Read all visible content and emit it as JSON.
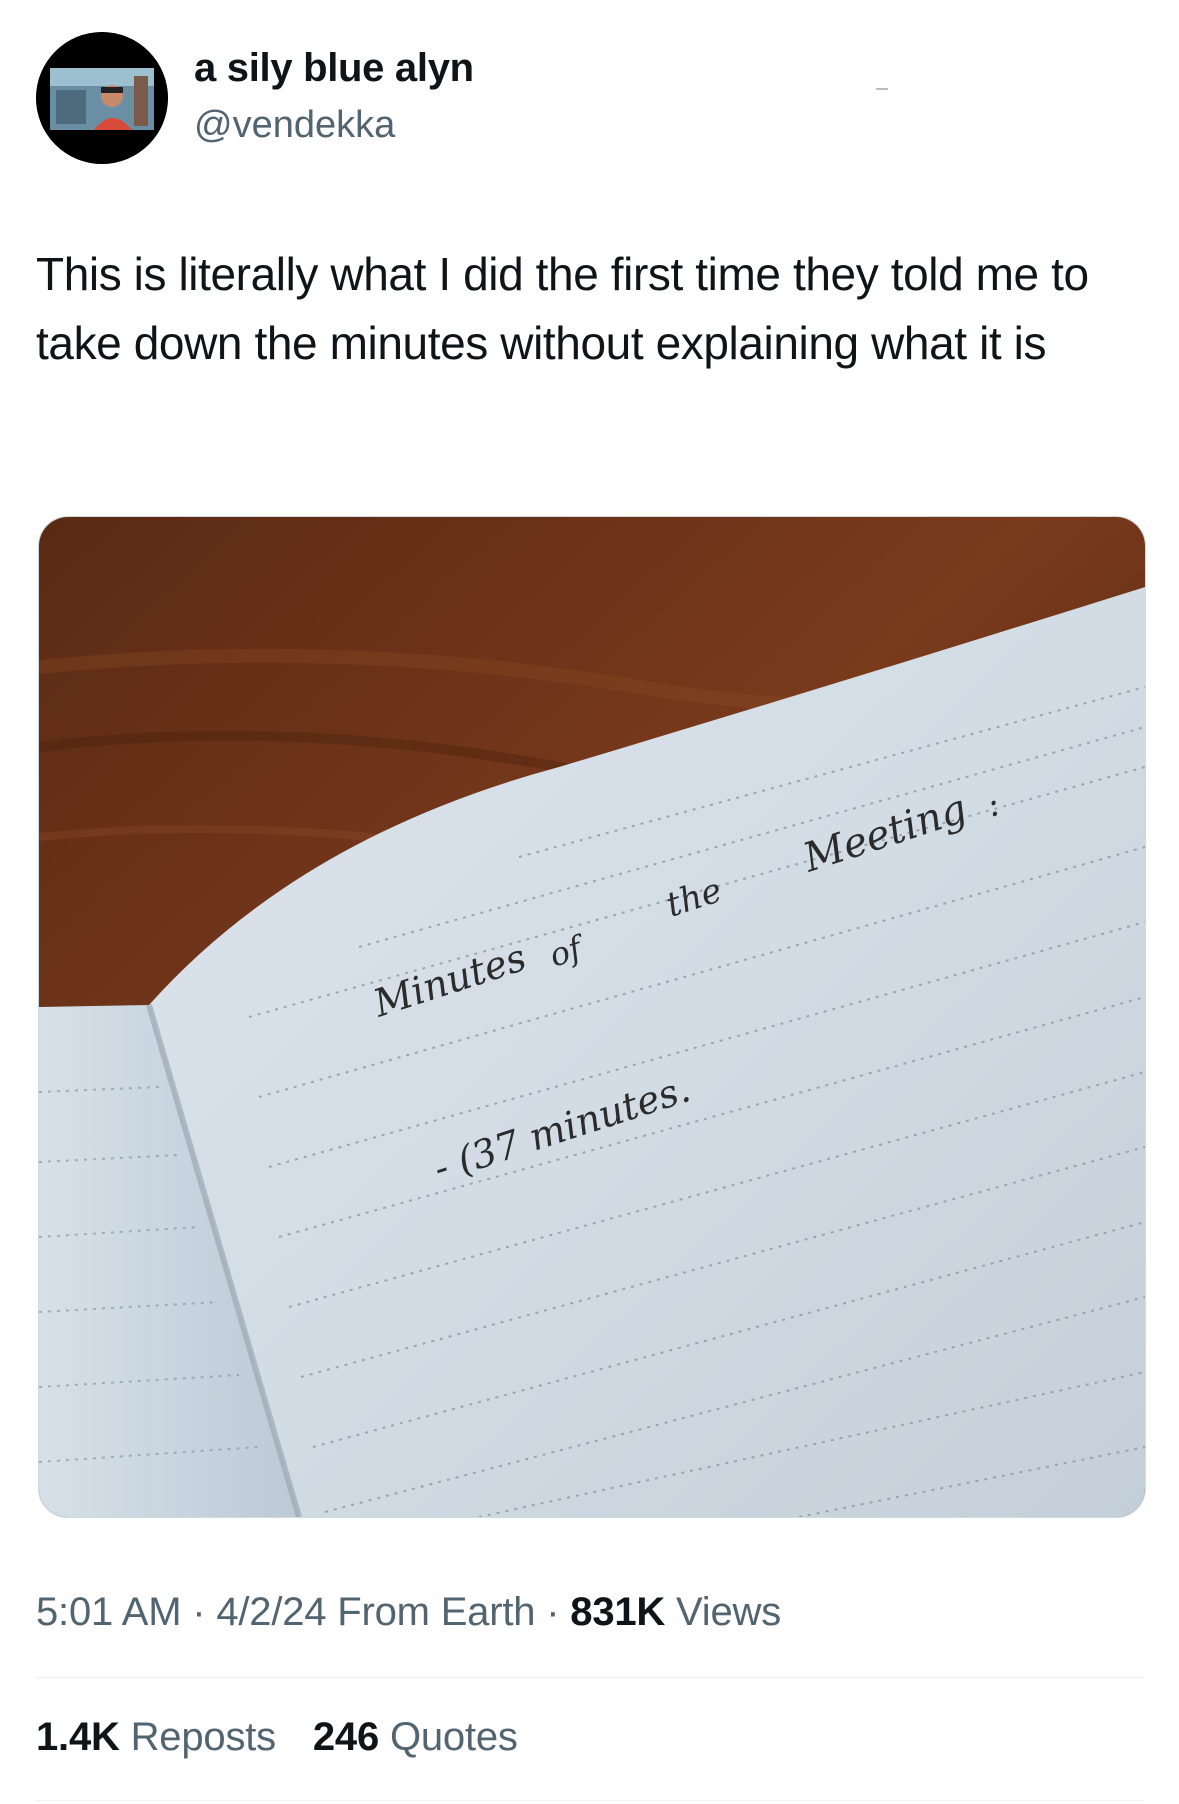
{
  "author": {
    "display_name": "a sily blue alyn",
    "handle": "@vendekka",
    "avatar_icon": "profile-photo-avatar"
  },
  "tweet": {
    "text": "This is literally what I did the first time they told me to take down the minutes without explaining what it is"
  },
  "photo": {
    "description_icon": "notebook-photo",
    "handwriting": {
      "line1": [
        "Minutes",
        "of",
        "the",
        "Meeting",
        ":"
      ],
      "line2": "- (37 minutes."
    }
  },
  "meta": {
    "time": "5:01 AM",
    "separator": "·",
    "date": "4/2/24",
    "source": "From Earth",
    "views_count": "831K",
    "views_label": "Views"
  },
  "stats": {
    "reposts_count": "1.4K",
    "reposts_label": "Reposts",
    "quotes_count": "246",
    "quotes_label": "Quotes"
  },
  "colors": {
    "text_primary": "#0f1419",
    "text_secondary": "#536471",
    "divider": "#eff3f4"
  }
}
